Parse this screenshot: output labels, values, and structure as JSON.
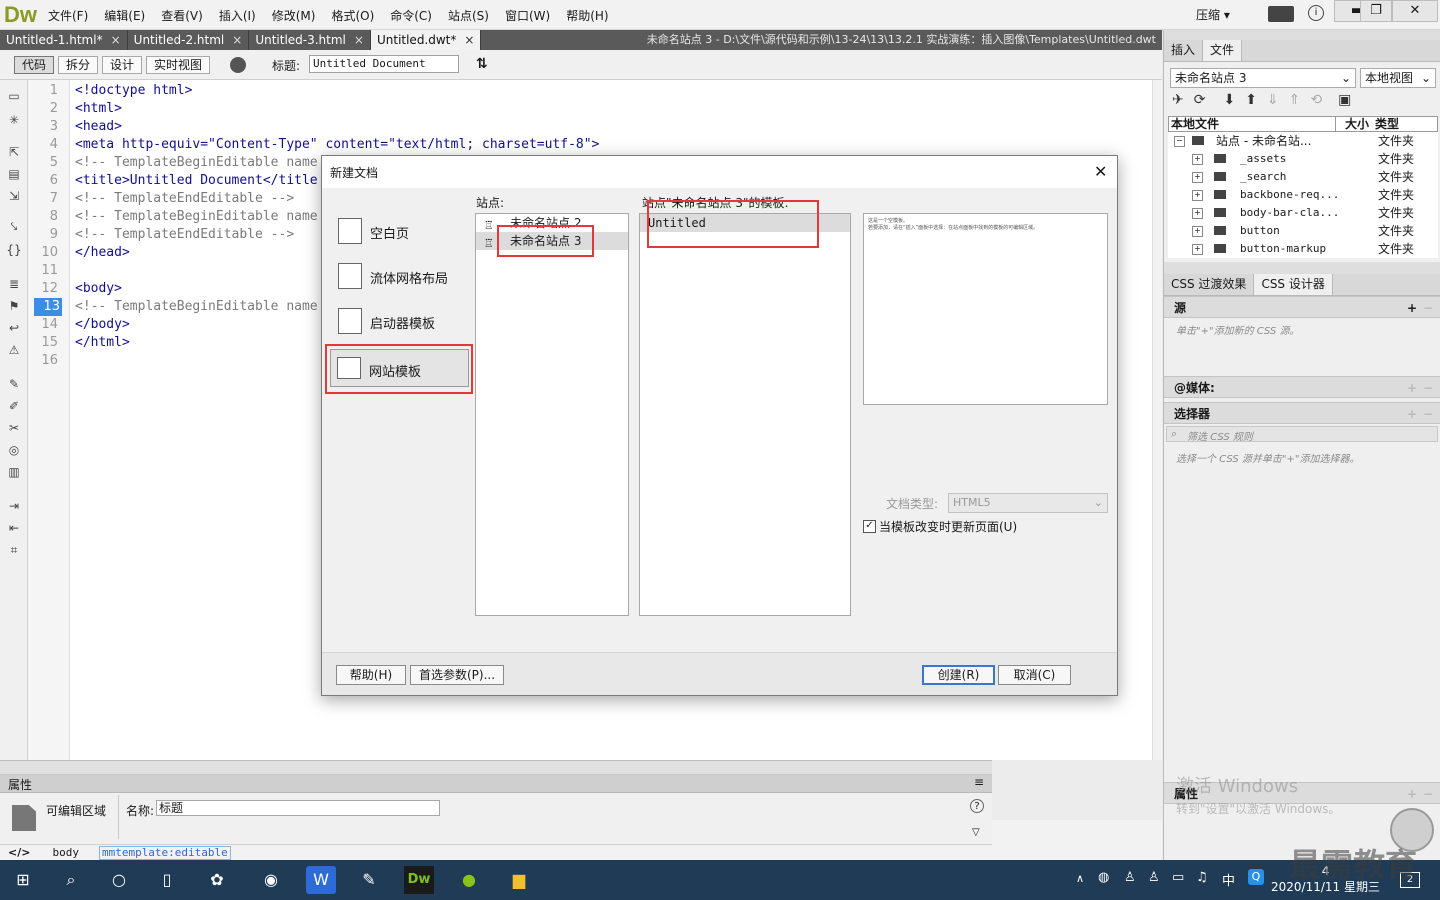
{
  "app": {
    "logo": "Dw",
    "menus": [
      "文件(F)",
      "编辑(E)",
      "查看(V)",
      "插入(I)",
      "修改(M)",
      "格式(O)",
      "命令(C)",
      "站点(S)",
      "窗口(W)",
      "帮助(H)"
    ],
    "compress_label": "压缩",
    "window_buttons": [
      "▬",
      "❐",
      "✕"
    ]
  },
  "tabs": [
    {
      "label": "Untitled-1.html*",
      "close": "×"
    },
    {
      "label": "Untitled-2.html",
      "close": "×"
    },
    {
      "label": "Untitled-3.html",
      "close": "×"
    },
    {
      "label": "Untitled.dwt*",
      "close": "×"
    }
  ],
  "doc_path": "未命名站点 3 - D:\\文件\\源代码和示例\\13-24\\13\\13.2.1  实战演练：插入图像\\Templates\\Untitled.dwt",
  "doc_toolbar": {
    "views": [
      "代码",
      "拆分",
      "设计",
      "实时视图"
    ],
    "title_label": "标题:",
    "title_value": "Untitled Document"
  },
  "code": {
    "current_line": 13,
    "lines": [
      {
        "n": "1",
        "text": "<!doctype html>",
        "c": false
      },
      {
        "n": "2",
        "text": "<html>",
        "c": false
      },
      {
        "n": "3",
        "text": "<head>",
        "c": false
      },
      {
        "n": "4",
        "text": "<meta http-equiv=\"Content-Type\" content=\"text/html; charset=utf-8\">",
        "c": false
      },
      {
        "n": "5",
        "text": "<!-- TemplateBeginEditable name",
        "c": true
      },
      {
        "n": "6",
        "text": "<title>Untitled Document</title",
        "c": false
      },
      {
        "n": "7",
        "text": "<!-- TemplateEndEditable -->",
        "c": true
      },
      {
        "n": "8",
        "text": "<!-- TemplateBeginEditable name",
        "c": true
      },
      {
        "n": "9",
        "text": "<!-- TemplateEndEditable -->",
        "c": true
      },
      {
        "n": "10",
        "text": "</head>",
        "c": false
      },
      {
        "n": "11",
        "text": "",
        "c": false
      },
      {
        "n": "12",
        "text": "<body>",
        "c": false
      },
      {
        "n": "13",
        "text": "<!-- TemplateBeginEditable name",
        "c": true
      },
      {
        "n": "14",
        "text": "</body>",
        "c": false
      },
      {
        "n": "15",
        "text": "</html>",
        "c": false
      },
      {
        "n": "16",
        "text": "",
        "c": false
      }
    ]
  },
  "dialog": {
    "title": "新建文档",
    "close": "✕",
    "categories": [
      "空白页",
      "流体网格布局",
      "启动器模板",
      "网站模板"
    ],
    "selected_category": 3,
    "sites_label": "站点:",
    "sites": [
      "未命名站点 2",
      "未命名站点 3"
    ],
    "selected_site": 1,
    "templates_label": "站点\"未命名站点 3\"的模板:",
    "templates": [
      "Untitled"
    ],
    "preview_lines": [
      "这是一个空模板。",
      "若要添加，请在“插入”面板中选择：在站点面板中找到的模板的可编辑区域。"
    ],
    "doctype_label": "文档类型:",
    "doctype_value": "HTML5",
    "update_label": "当模板改变时更新页面(U)",
    "update_checked": true,
    "help_btn": "帮助(H)",
    "prefs_btn": "首选参数(P)...",
    "create_btn": "创建(R)",
    "cancel_btn": "取消(C)"
  },
  "right_panel": {
    "tabs": [
      "插入",
      "文件"
    ],
    "site_select": "未命名站点 3",
    "view_select": "本地视图",
    "headers": [
      "本地文件",
      "大小",
      "类型"
    ],
    "root": {
      "name": "站点 - 未命名站...",
      "type": "文件夹"
    },
    "files": [
      {
        "name": "_assets",
        "type": "文件夹"
      },
      {
        "name": "_search",
        "type": "文件夹"
      },
      {
        "name": "backbone-req...",
        "type": "文件夹"
      },
      {
        "name": "body-bar-cla...",
        "type": "文件夹"
      },
      {
        "name": "button",
        "type": "文件夹"
      },
      {
        "name": "button-markup",
        "type": "文件夹"
      }
    ],
    "css_tabs": [
      "CSS 过渡效果",
      "CSS 设计器"
    ],
    "source_header": "源",
    "source_hint": "单击\"+\"添加新的 CSS 源。",
    "media_header": "@媒体:",
    "selector_header": "选择器",
    "selector_filter": "筛选 CSS 规则",
    "selector_hint": "选择一个 CSS 源并单击\"+\"添加选择器。",
    "props_header": "属性"
  },
  "properties": {
    "header": "属性",
    "kind": "可编辑区域",
    "name_label": "名称:",
    "name_value": "标题"
  },
  "status": {
    "tags": [
      "body",
      "mmtemplate:editable"
    ]
  },
  "overlay": {
    "activate_title": "激活 Windows",
    "activate_sub": "转到\"设置\"以激活 Windows。",
    "watermark": "最需教育"
  },
  "taskbar": {
    "time": "4",
    "date": "2020/11/11 星期三",
    "ime": "中",
    "notif": "2"
  }
}
